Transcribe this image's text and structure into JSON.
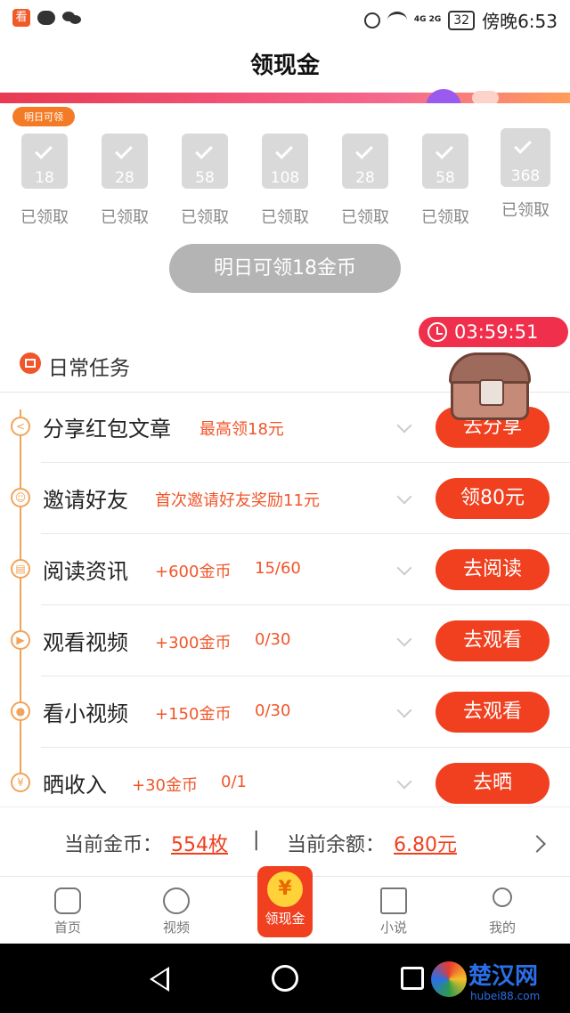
{
  "status_bar": {
    "app_badge": "看",
    "battery": "32",
    "time": "傍晚6:53",
    "signal": "4G 2G"
  },
  "header": {
    "title": "领现金"
  },
  "checkin": {
    "tomorrow_tag": "明日可领",
    "days": [
      {
        "amount": "18",
        "label": "已领取"
      },
      {
        "amount": "28",
        "label": "已领取"
      },
      {
        "amount": "58",
        "label": "已领取"
      },
      {
        "amount": "108",
        "label": "已领取"
      },
      {
        "amount": "28",
        "label": "已领取"
      },
      {
        "amount": "58",
        "label": "已领取"
      },
      {
        "amount": "368",
        "label": "已领取"
      }
    ],
    "claim_button": "明日可领18金币"
  },
  "timer": "03:59:51",
  "section": {
    "title": "日常任务"
  },
  "tasks": [
    {
      "name": "分享红包文章",
      "desc": "最高领18元",
      "progress": "",
      "button": "去分享",
      "icon": "share-icon"
    },
    {
      "name": "邀请好友",
      "desc": "首次邀请好友奖励11元",
      "progress": "",
      "button": "领80元",
      "icon": "invite-icon"
    },
    {
      "name": "阅读资讯",
      "desc": "+600金币",
      "progress": "15/60",
      "button": "去阅读",
      "icon": "read-icon"
    },
    {
      "name": "观看视频",
      "desc": "+300金币",
      "progress": "0/30",
      "button": "去观看",
      "icon": "play-icon"
    },
    {
      "name": "看小视频",
      "desc": "+150金币",
      "progress": "0/30",
      "button": "去观看",
      "icon": "small-video-icon"
    },
    {
      "name": "晒收入",
      "desc": "+30金币",
      "progress": "0/1",
      "button": "去晒",
      "icon": "income-icon"
    }
  ],
  "footer": {
    "coin_label": "当前金币：",
    "coin_value": "554枚",
    "separator": "|",
    "balance_label": "当前余额：",
    "balance_value": "6.80元"
  },
  "tabbar": {
    "items": [
      "首页",
      "视频",
      "领现金",
      "小说",
      "我的"
    ],
    "center_symbol": "¥"
  },
  "watermark": {
    "text": "楚汉网",
    "url": "hubei88.com"
  },
  "colors": {
    "accent": "#f0401f",
    "timeline": "#f2a35a",
    "timer": "#ef2f4b"
  }
}
